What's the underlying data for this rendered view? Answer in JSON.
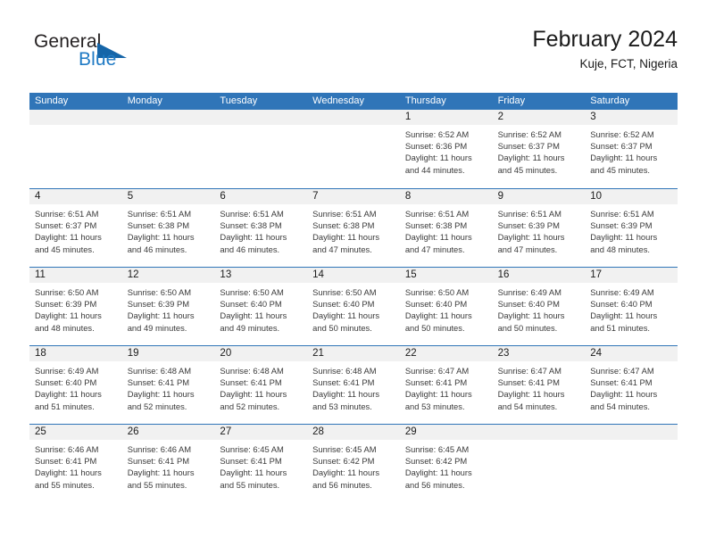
{
  "brand": {
    "name_top": "General",
    "name_bottom": "Blue",
    "triangle_color": "#1565a8",
    "blue_color": "#1f7ac4"
  },
  "header": {
    "title": "February 2024",
    "subtitle": "Kuje, FCT, Nigeria",
    "accent_color": "#3075b8",
    "band_color": "#f1f1f1"
  },
  "weekdays": [
    "Sunday",
    "Monday",
    "Tuesday",
    "Wednesday",
    "Thursday",
    "Friday",
    "Saturday"
  ],
  "weeks": [
    [
      {
        "day": ""
      },
      {
        "day": ""
      },
      {
        "day": ""
      },
      {
        "day": ""
      },
      {
        "day": "1",
        "sunrise": "Sunrise: 6:52 AM",
        "sunset": "Sunset: 6:36 PM",
        "daylight": "Daylight: 11 hours and 44 minutes."
      },
      {
        "day": "2",
        "sunrise": "Sunrise: 6:52 AM",
        "sunset": "Sunset: 6:37 PM",
        "daylight": "Daylight: 11 hours and 45 minutes."
      },
      {
        "day": "3",
        "sunrise": "Sunrise: 6:52 AM",
        "sunset": "Sunset: 6:37 PM",
        "daylight": "Daylight: 11 hours and 45 minutes."
      }
    ],
    [
      {
        "day": "4",
        "sunrise": "Sunrise: 6:51 AM",
        "sunset": "Sunset: 6:37 PM",
        "daylight": "Daylight: 11 hours and 45 minutes."
      },
      {
        "day": "5",
        "sunrise": "Sunrise: 6:51 AM",
        "sunset": "Sunset: 6:38 PM",
        "daylight": "Daylight: 11 hours and 46 minutes."
      },
      {
        "day": "6",
        "sunrise": "Sunrise: 6:51 AM",
        "sunset": "Sunset: 6:38 PM",
        "daylight": "Daylight: 11 hours and 46 minutes."
      },
      {
        "day": "7",
        "sunrise": "Sunrise: 6:51 AM",
        "sunset": "Sunset: 6:38 PM",
        "daylight": "Daylight: 11 hours and 47 minutes."
      },
      {
        "day": "8",
        "sunrise": "Sunrise: 6:51 AM",
        "sunset": "Sunset: 6:38 PM",
        "daylight": "Daylight: 11 hours and 47 minutes."
      },
      {
        "day": "9",
        "sunrise": "Sunrise: 6:51 AM",
        "sunset": "Sunset: 6:39 PM",
        "daylight": "Daylight: 11 hours and 47 minutes."
      },
      {
        "day": "10",
        "sunrise": "Sunrise: 6:51 AM",
        "sunset": "Sunset: 6:39 PM",
        "daylight": "Daylight: 11 hours and 48 minutes."
      }
    ],
    [
      {
        "day": "11",
        "sunrise": "Sunrise: 6:50 AM",
        "sunset": "Sunset: 6:39 PM",
        "daylight": "Daylight: 11 hours and 48 minutes."
      },
      {
        "day": "12",
        "sunrise": "Sunrise: 6:50 AM",
        "sunset": "Sunset: 6:39 PM",
        "daylight": "Daylight: 11 hours and 49 minutes."
      },
      {
        "day": "13",
        "sunrise": "Sunrise: 6:50 AM",
        "sunset": "Sunset: 6:40 PM",
        "daylight": "Daylight: 11 hours and 49 minutes."
      },
      {
        "day": "14",
        "sunrise": "Sunrise: 6:50 AM",
        "sunset": "Sunset: 6:40 PM",
        "daylight": "Daylight: 11 hours and 50 minutes."
      },
      {
        "day": "15",
        "sunrise": "Sunrise: 6:50 AM",
        "sunset": "Sunset: 6:40 PM",
        "daylight": "Daylight: 11 hours and 50 minutes."
      },
      {
        "day": "16",
        "sunrise": "Sunrise: 6:49 AM",
        "sunset": "Sunset: 6:40 PM",
        "daylight": "Daylight: 11 hours and 50 minutes."
      },
      {
        "day": "17",
        "sunrise": "Sunrise: 6:49 AM",
        "sunset": "Sunset: 6:40 PM",
        "daylight": "Daylight: 11 hours and 51 minutes."
      }
    ],
    [
      {
        "day": "18",
        "sunrise": "Sunrise: 6:49 AM",
        "sunset": "Sunset: 6:40 PM",
        "daylight": "Daylight: 11 hours and 51 minutes."
      },
      {
        "day": "19",
        "sunrise": "Sunrise: 6:48 AM",
        "sunset": "Sunset: 6:41 PM",
        "daylight": "Daylight: 11 hours and 52 minutes."
      },
      {
        "day": "20",
        "sunrise": "Sunrise: 6:48 AM",
        "sunset": "Sunset: 6:41 PM",
        "daylight": "Daylight: 11 hours and 52 minutes."
      },
      {
        "day": "21",
        "sunrise": "Sunrise: 6:48 AM",
        "sunset": "Sunset: 6:41 PM",
        "daylight": "Daylight: 11 hours and 53 minutes."
      },
      {
        "day": "22",
        "sunrise": "Sunrise: 6:47 AM",
        "sunset": "Sunset: 6:41 PM",
        "daylight": "Daylight: 11 hours and 53 minutes."
      },
      {
        "day": "23",
        "sunrise": "Sunrise: 6:47 AM",
        "sunset": "Sunset: 6:41 PM",
        "daylight": "Daylight: 11 hours and 54 minutes."
      },
      {
        "day": "24",
        "sunrise": "Sunrise: 6:47 AM",
        "sunset": "Sunset: 6:41 PM",
        "daylight": "Daylight: 11 hours and 54 minutes."
      }
    ],
    [
      {
        "day": "25",
        "sunrise": "Sunrise: 6:46 AM",
        "sunset": "Sunset: 6:41 PM",
        "daylight": "Daylight: 11 hours and 55 minutes."
      },
      {
        "day": "26",
        "sunrise": "Sunrise: 6:46 AM",
        "sunset": "Sunset: 6:41 PM",
        "daylight": "Daylight: 11 hours and 55 minutes."
      },
      {
        "day": "27",
        "sunrise": "Sunrise: 6:45 AM",
        "sunset": "Sunset: 6:41 PM",
        "daylight": "Daylight: 11 hours and 55 minutes."
      },
      {
        "day": "28",
        "sunrise": "Sunrise: 6:45 AM",
        "sunset": "Sunset: 6:42 PM",
        "daylight": "Daylight: 11 hours and 56 minutes."
      },
      {
        "day": "29",
        "sunrise": "Sunrise: 6:45 AM",
        "sunset": "Sunset: 6:42 PM",
        "daylight": "Daylight: 11 hours and 56 minutes."
      },
      {
        "day": ""
      },
      {
        "day": ""
      }
    ]
  ]
}
